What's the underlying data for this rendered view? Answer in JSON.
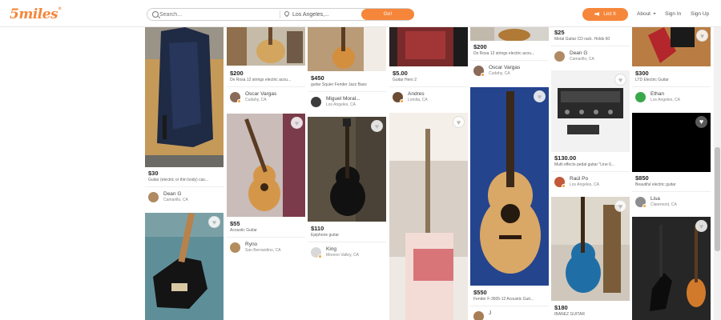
{
  "header": {
    "logo": "5miles",
    "search_placeholder": "Search...",
    "location_value": "Los Angeles,...",
    "go_label": "Go!",
    "list_label": "List It",
    "about_label": "About",
    "signin_label": "Sign In",
    "signup_label": "Sign Up"
  },
  "listings": [
    {
      "price": "$30",
      "title": "Guitar (electric or thin body) cas...",
      "seller": "Dean G",
      "location": "Camarillo, CA"
    },
    {
      "price": "",
      "title": "",
      "seller": "",
      "location": ""
    },
    {
      "price": "$200",
      "title": "De Rosa 12 strings electric acou...",
      "seller": "Oscar Vargas",
      "location": "Cudahy, CA"
    },
    {
      "price": "$55",
      "title": "Acoustic Guitar",
      "seller": "Ryno",
      "location": "San Bernardino, CA"
    },
    {
      "price": "$450",
      "title": "guitar Squier Fender Jazz Bass",
      "seller": "Miguel Moral...",
      "location": "Los Angeles, CA"
    },
    {
      "price": "$110",
      "title": "Epiphone guitar",
      "seller": "King",
      "location": "Moreno Valley, CA"
    },
    {
      "price": "$5.00",
      "title": "Guitar Hero 2",
      "seller": "Andres",
      "location": "Lomita, CA"
    },
    {
      "price": "",
      "title": "",
      "seller": "",
      "location": ""
    },
    {
      "price": "$200",
      "title": "De Rosa 12 strings electric acou...",
      "seller": "Oscar Vargas",
      "location": "Cudahy, CA"
    },
    {
      "price": "$550",
      "title": "Fender F-3605-12 Acoustic Guit...",
      "seller": "J",
      "location": ""
    },
    {
      "price": "$25",
      "title": "Metal Guitar CD rack. Holds 60",
      "seller": "Dean G",
      "location": "Camarillo, CA"
    },
    {
      "price": "$130.00",
      "title": "Multi effects pedal guitar \"Line 6...",
      "seller": "Raúl Po",
      "location": "Los Angeles, CA"
    },
    {
      "price": "$180",
      "title": "IBANEZ GUITAR",
      "seller": "",
      "location": ""
    },
    {
      "price": "$300",
      "title": "LTD Electric Guitar",
      "seller": "Ethan",
      "location": "Los Angeles, CA"
    },
    {
      "price": "$850",
      "title": "Beautiful electric guitar",
      "seller": "Lisa",
      "location": "Claremont, CA"
    }
  ]
}
